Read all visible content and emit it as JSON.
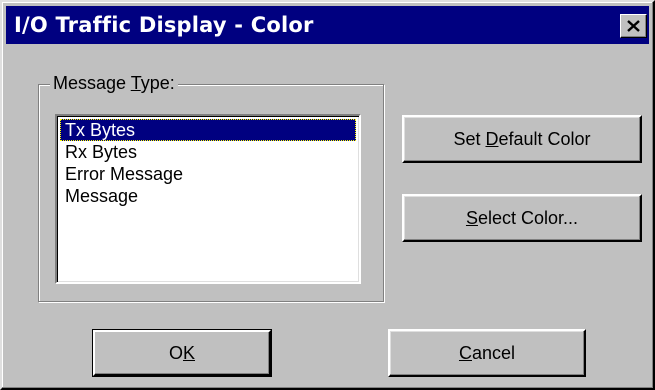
{
  "window": {
    "title": "I/O Traffic Display - Color"
  },
  "group": {
    "label_before": "Message ",
    "label_accel": "T",
    "label_after": "ype:"
  },
  "list": {
    "items": [
      "Tx Bytes",
      "Rx Bytes",
      "Error Message",
      "Message"
    ],
    "selected": "Tx Bytes"
  },
  "buttons": {
    "set_default_before": "Set ",
    "set_default_accel": "D",
    "set_default_after": "efault Color",
    "select_color_accel": "S",
    "select_color_after": "elect Color...",
    "ok_before": "O",
    "ok_accel": "K",
    "cancel_accel": "C",
    "cancel_after": "ancel"
  },
  "icons": {
    "close": "close-icon"
  },
  "colors": {
    "titlebar": "#000080",
    "face": "#c0c0c0",
    "selection": "#000080"
  }
}
